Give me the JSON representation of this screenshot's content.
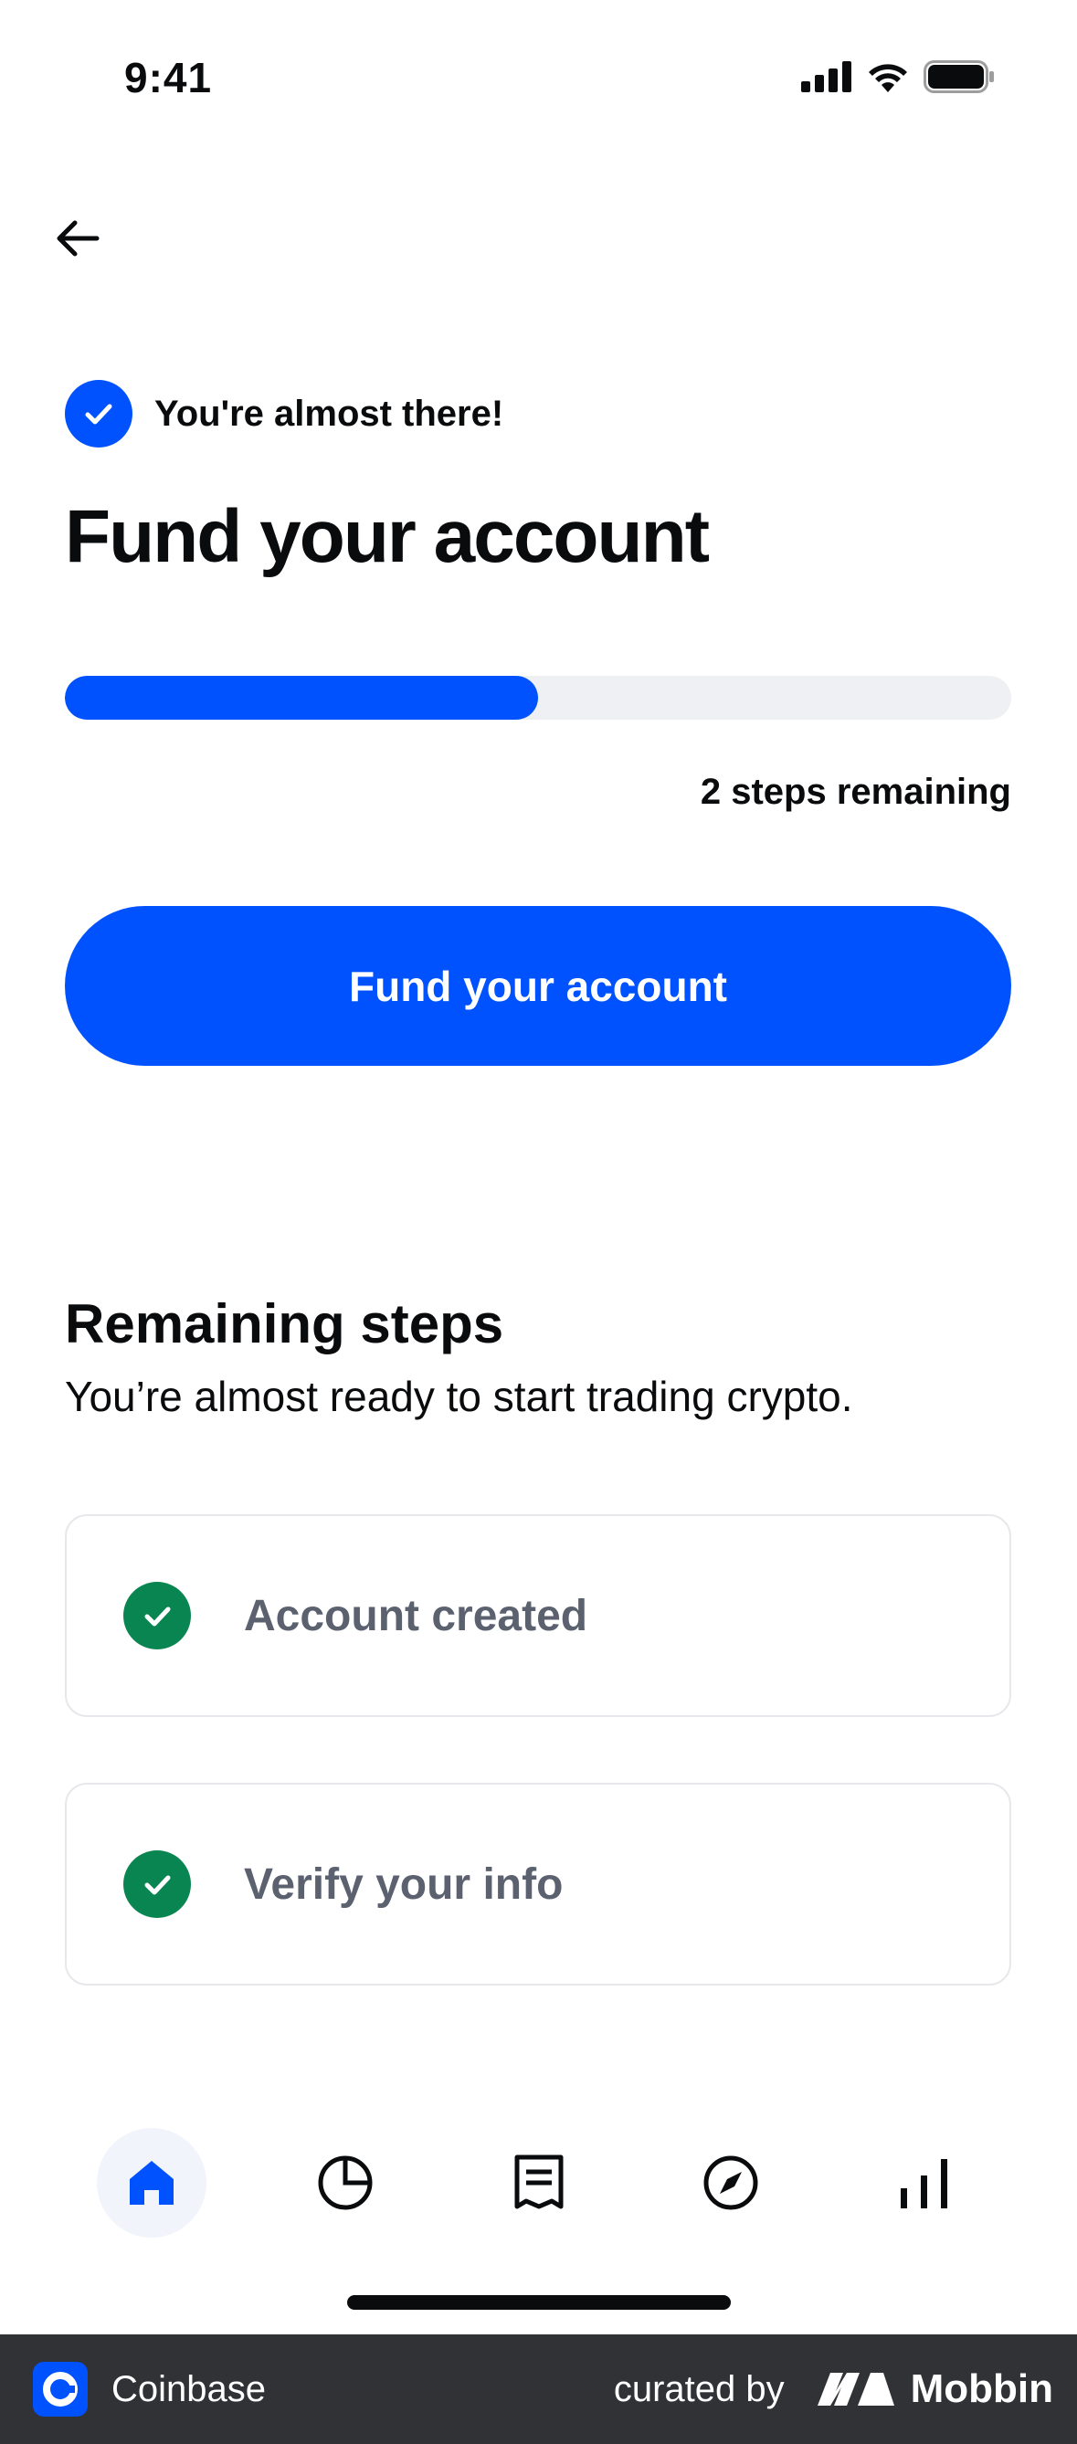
{
  "status_bar": {
    "time": "9:41",
    "icons": [
      "signal-icon",
      "wifi-icon",
      "battery-icon"
    ]
  },
  "header": {
    "back_icon": "arrow-left-icon"
  },
  "badge": {
    "icon": "check-circle-icon",
    "text": "You're almost there!"
  },
  "title": "Fund your account",
  "progress": {
    "fraction": 0.5,
    "label": "2 steps remaining"
  },
  "cta": {
    "label": "Fund your account"
  },
  "remaining": {
    "title": "Remaining steps",
    "subtitle": "You’re almost ready to start trading crypto.",
    "steps": [
      {
        "label": "Account created",
        "status": "complete"
      },
      {
        "label": "Verify your info",
        "status": "complete"
      }
    ]
  },
  "bottom_nav": {
    "items": [
      {
        "icon": "home-icon",
        "active": true
      },
      {
        "icon": "portfolio-pie-icon",
        "active": false
      },
      {
        "icon": "transactions-receipt-icon",
        "active": false
      },
      {
        "icon": "explore-compass-icon",
        "active": false
      },
      {
        "icon": "markets-bars-icon",
        "active": false
      }
    ]
  },
  "footer": {
    "app_name": "Coinbase",
    "curated_by": "curated by",
    "brand": "Mobbin"
  },
  "colors": {
    "primary": "#0052ff",
    "success": "#098551",
    "muted_text": "#5b616e",
    "track": "#eef0f3",
    "footer_bg": "#303236"
  }
}
